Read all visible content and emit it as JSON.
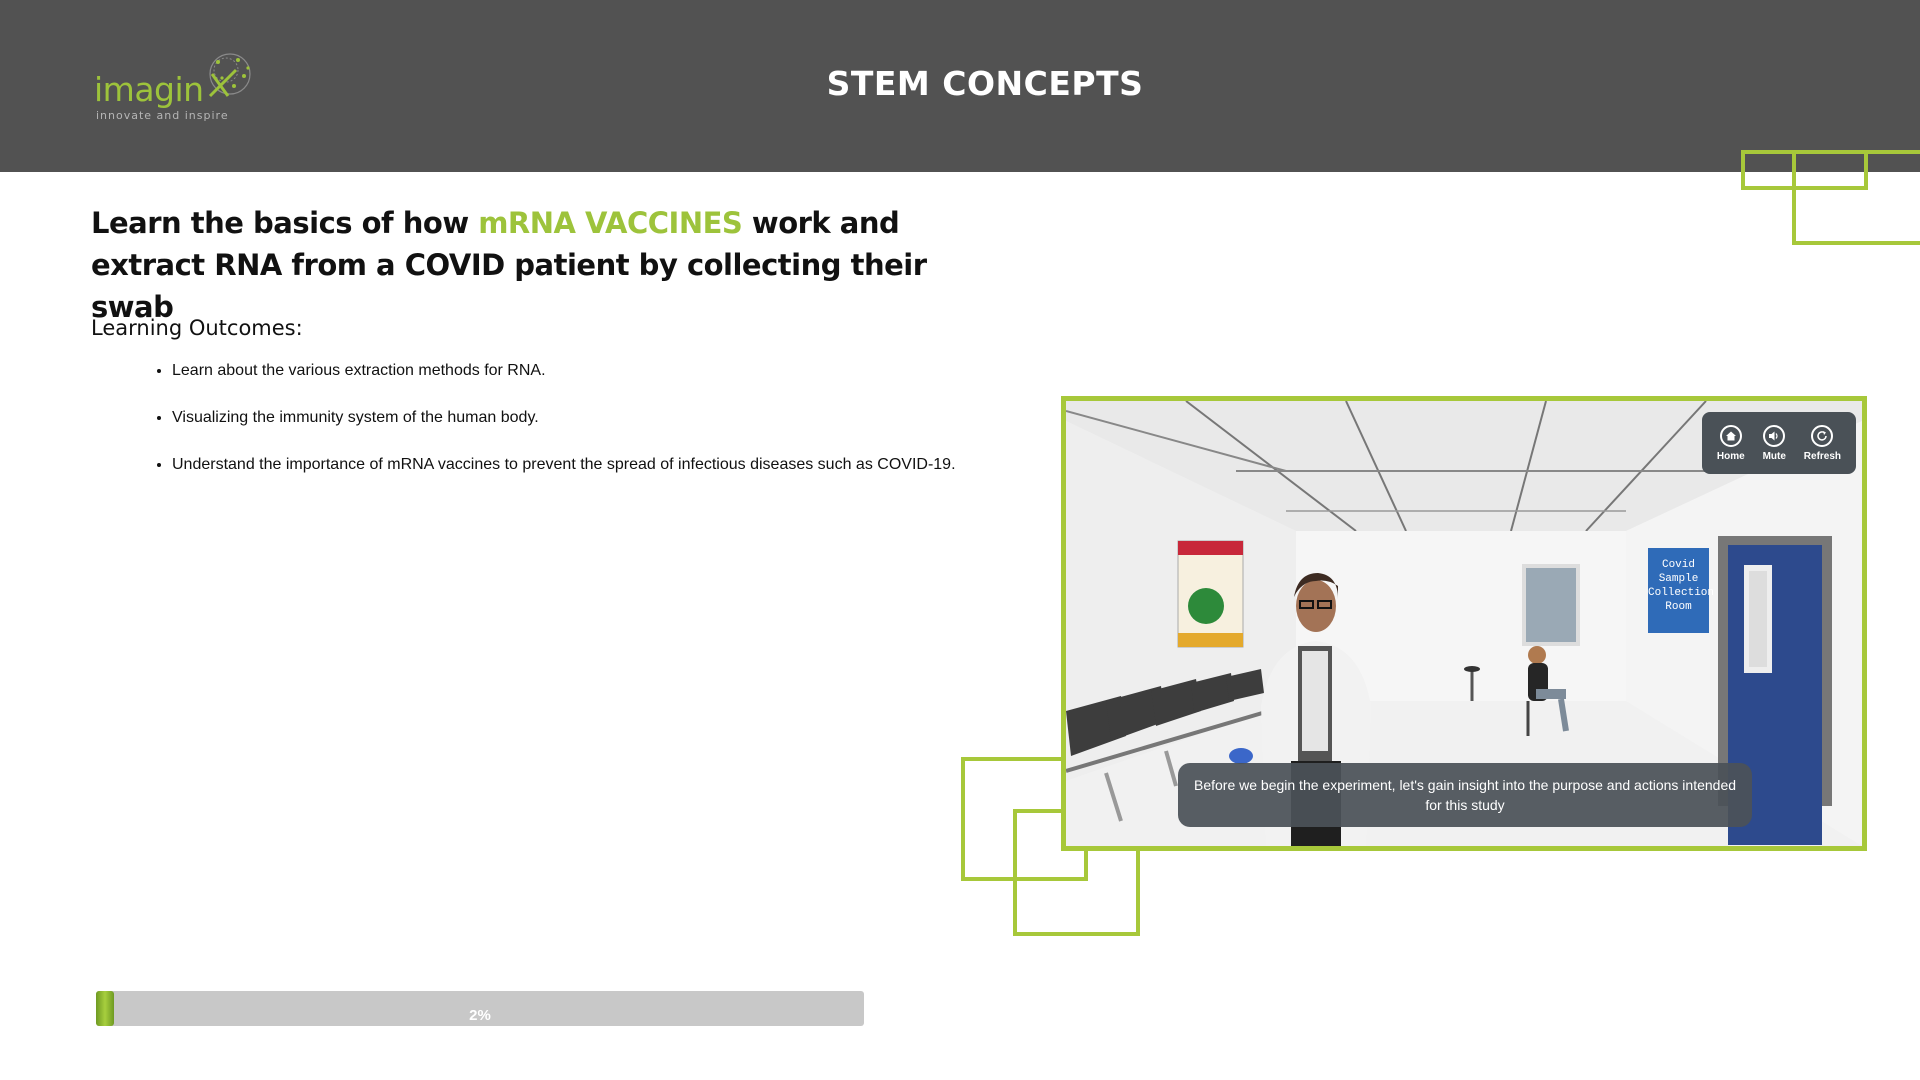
{
  "header": {
    "title": "STEM CONCEPTS",
    "logo": {
      "word": "imagin",
      "tagline": "innovate and inspire"
    }
  },
  "intro": {
    "headline_before": "Learn the basics of how ",
    "headline_accent": "mRNA VACCINES",
    "headline_after": " work and extract RNA from a COVID patient by collecting their swab",
    "outcomes_title": "Learning Outcomes:",
    "outcomes": [
      "Learn about the various extraction methods for RNA.",
      "Visualizing the immunity system of the human body.",
      "Understand the importance of mRNA vaccines to prevent the spread of infectious diseases such as COVID-19."
    ]
  },
  "video": {
    "controls": [
      {
        "label": "Home",
        "icon": "home-icon"
      },
      {
        "label": "Mute",
        "icon": "speaker-icon"
      },
      {
        "label": "Refresh",
        "icon": "refresh-icon"
      }
    ],
    "room_sign": "Covid Sample Collection Room",
    "subtitle": "Before we begin the experiment, let's gain insight into the purpose and actions intended for this study"
  },
  "progress": {
    "value_percent": 2,
    "label": "2%"
  },
  "colors": {
    "accent": "#9dc33b",
    "header_bg": "#525252",
    "frame": "#a7c83a"
  }
}
